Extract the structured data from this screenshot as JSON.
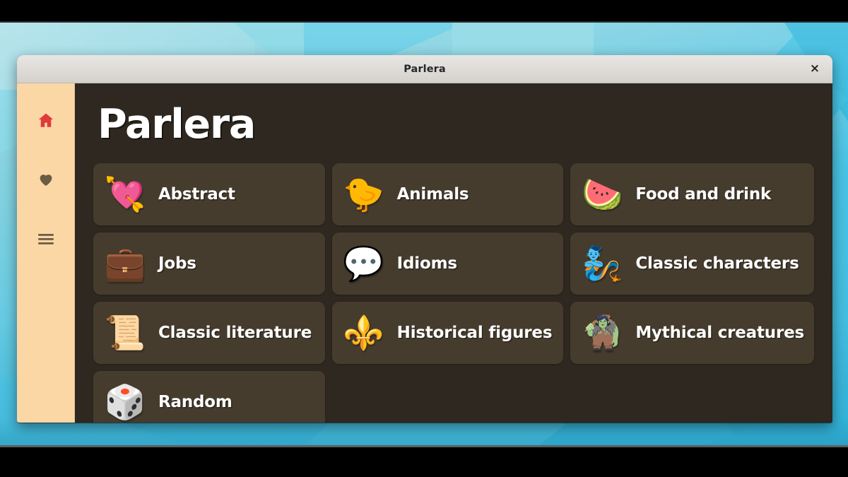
{
  "window": {
    "title": "Parlera",
    "close_label": "×"
  },
  "sidebar": {
    "items": [
      {
        "icon": "home-icon",
        "active": true
      },
      {
        "icon": "heart-icon",
        "active": false
      },
      {
        "icon": "hamburger-menu-icon",
        "active": false
      }
    ]
  },
  "main": {
    "heading": "Parlera",
    "categories": [
      {
        "emoji": "💘",
        "icon_name": "heart-with-arrow-icon",
        "label": "Abstract"
      },
      {
        "emoji": "🐤",
        "icon_name": "baby-chick-icon",
        "label": "Animals"
      },
      {
        "emoji": "🍉",
        "icon_name": "watermelon-icon",
        "label": "Food and drink"
      },
      {
        "emoji": "💼",
        "icon_name": "briefcase-icon",
        "label": "Jobs"
      },
      {
        "emoji": "💬",
        "icon_name": "speech-balloon-icon",
        "label": "Idioms"
      },
      {
        "emoji": "🧞",
        "icon_name": "genie-icon",
        "label": "Classic characters"
      },
      {
        "emoji": "📜",
        "icon_name": "scroll-icon",
        "label": "Classic literature"
      },
      {
        "emoji": "⚜️",
        "icon_name": "fleur-de-lis-icon",
        "label": "Historical figures"
      },
      {
        "emoji": "🧌",
        "icon_name": "troll-icon",
        "label": "Mythical creatures"
      },
      {
        "emoji": "🎲",
        "icon_name": "game-die-icon",
        "label": "Random"
      }
    ]
  },
  "colors": {
    "sidebar_bg": "#fbd7a5",
    "content_bg": "#2e2820",
    "card_bg": "#463c2e",
    "home_icon": "#e03a3a",
    "heart_icon": "#6b5c45",
    "menu_icon": "#6b5c45",
    "titlebar_bg": "#dedbd7",
    "desktop_accent": "#49c3e4"
  }
}
